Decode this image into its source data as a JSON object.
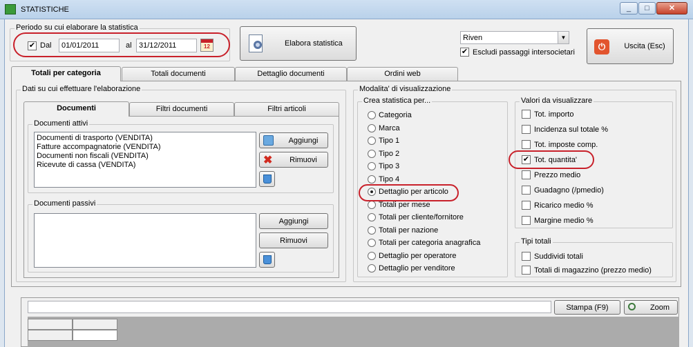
{
  "window": {
    "title": "STATISTICHE",
    "minimize": "_",
    "maximize": "□",
    "close": "✕"
  },
  "period": {
    "legend": "Periodo su cui elaborare la statistica",
    "from_label": "Dal",
    "from_checked": true,
    "from_value": "01/01/2011",
    "to_label": "al",
    "to_value": "31/12/2011",
    "calendar_icon": "calendar-icon"
  },
  "elabora_button": "Elabora statistica",
  "dropdown": {
    "value": "Riven",
    "arrow": "▼"
  },
  "exclude": {
    "label": "Escludi passaggi intersocietari",
    "checked": true
  },
  "exit_button": "Uscita (Esc)",
  "main_tabs": [
    "Totali per categoria",
    "Totali documenti",
    "Dettaglio documenti",
    "Ordini web"
  ],
  "data_group": {
    "legend": "Dati su cui effettuare l'elaborazione",
    "tabs": [
      "Documenti",
      "Filtri documenti",
      "Filtri articoli"
    ],
    "active_docs": {
      "legend": "Documenti attivi",
      "items": [
        "Documenti di trasporto (VENDITA)",
        "Fatture accompagnatorie (VENDITA)",
        "Documenti non fiscali (VENDITA)",
        "Ricevute di cassa (VENDITA)"
      ],
      "add": "Aggiungi",
      "remove": "Rimuovi"
    },
    "passive_docs": {
      "legend": "Documenti passivi",
      "items": [],
      "add": "Aggiungi",
      "remove": "Rimuovi"
    }
  },
  "display_group": {
    "legend": "Modalita' di visualizzazione",
    "create": {
      "legend": "Crea statistica per...",
      "options": [
        "Categoria",
        "Marca",
        "Tipo 1",
        "Tipo 2",
        "Tipo 3",
        "Tipo 4",
        "Dettaglio per articolo",
        "Totali per mese",
        "Totali per cliente/fornitore",
        "Totali per nazione",
        "Totali per categoria anagrafica",
        "Dettaglio per operatore",
        "Dettaglio per venditore"
      ],
      "selected": "Dettaglio per articolo"
    },
    "values": {
      "legend": "Valori da visualizzare",
      "options": [
        "Tot. importo",
        "Incidenza sul totale %",
        "Tot. imposte comp.",
        "Tot. quantita'",
        "Prezzo medio",
        "Guadagno (/pmedio)",
        "Ricarico medio %",
        "Margine medio %"
      ],
      "checked": [
        "Tot. quantita'"
      ]
    },
    "totals": {
      "legend": "Tipi totali",
      "options": [
        "Suddividi totali",
        "Totali di magazzino (prezzo medio)"
      ]
    }
  },
  "bottom": {
    "print_button": "Stampa (F9)",
    "zoom_button": "Zoom"
  }
}
